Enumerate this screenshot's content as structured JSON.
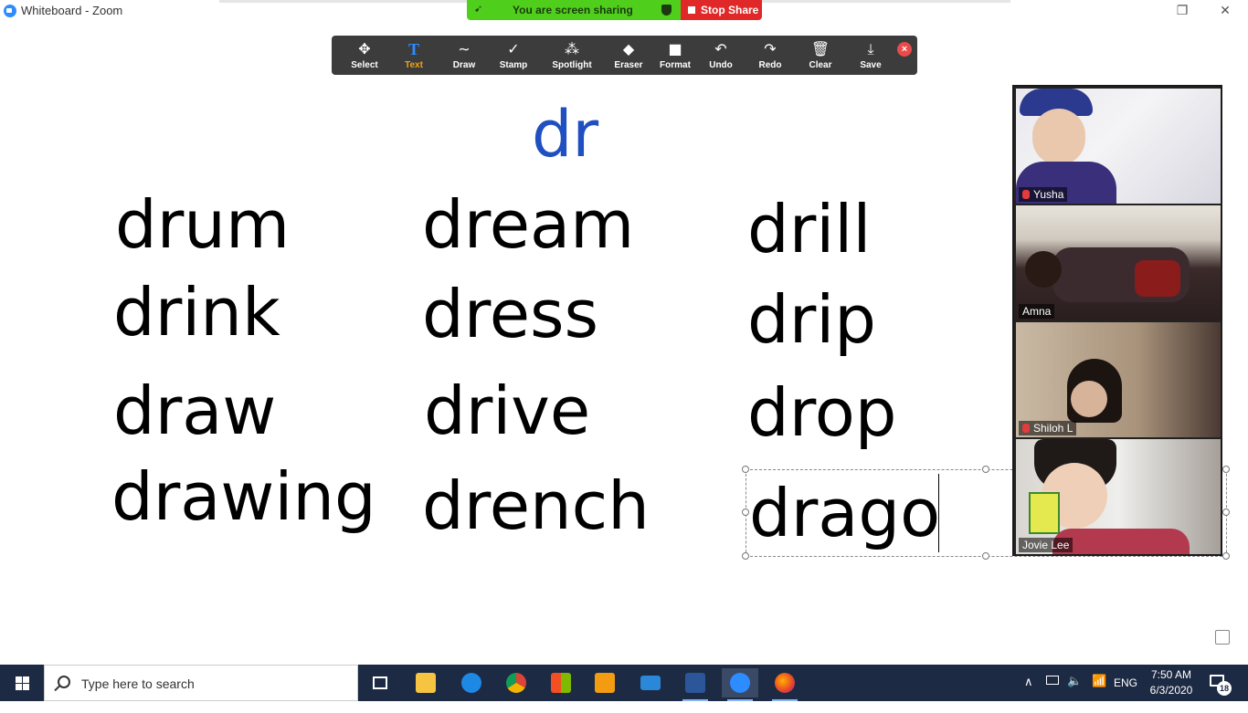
{
  "window": {
    "title": "Whiteboard - Zoom"
  },
  "share_banner": {
    "status": "You are screen sharing",
    "stop_label": "Stop Share"
  },
  "toolbar": {
    "tools": [
      {
        "label": "Select",
        "icon": "✥"
      },
      {
        "label": "Text",
        "icon": "T"
      },
      {
        "label": "Draw",
        "icon": "∼"
      },
      {
        "label": "Stamp",
        "icon": "✓"
      },
      {
        "label": "Spotlight",
        "icon": "⁂"
      },
      {
        "label": "Eraser",
        "icon": "◆"
      },
      {
        "label": "Format",
        "icon": "■"
      },
      {
        "label": "Undo",
        "icon": "↶"
      },
      {
        "label": "Redo",
        "icon": "↷"
      },
      {
        "label": "Clear",
        "icon": "🗑"
      },
      {
        "label": "Save",
        "icon": "⤓"
      }
    ],
    "active_tool": "Text",
    "close_icon": "×"
  },
  "whiteboard": {
    "heading": "dr",
    "heading_color": "#1F4FC0",
    "columns": [
      [
        "drum",
        "drink",
        "draw",
        "drawing"
      ],
      [
        "dream",
        "dress",
        "drive",
        "drench"
      ],
      [
        "drill",
        "drip",
        "drop",
        "drago"
      ]
    ]
  },
  "participants": [
    {
      "name": "Yusha",
      "muted": true
    },
    {
      "name": "Amna",
      "muted": false
    },
    {
      "name": "Shiloh L",
      "muted": true
    },
    {
      "name": "Jovie Lee",
      "muted": false
    }
  ],
  "taskbar": {
    "search_placeholder": "Type here to search",
    "language": "ENG",
    "time": "7:50 AM",
    "date": "6/3/2020",
    "notification_count": "18"
  }
}
